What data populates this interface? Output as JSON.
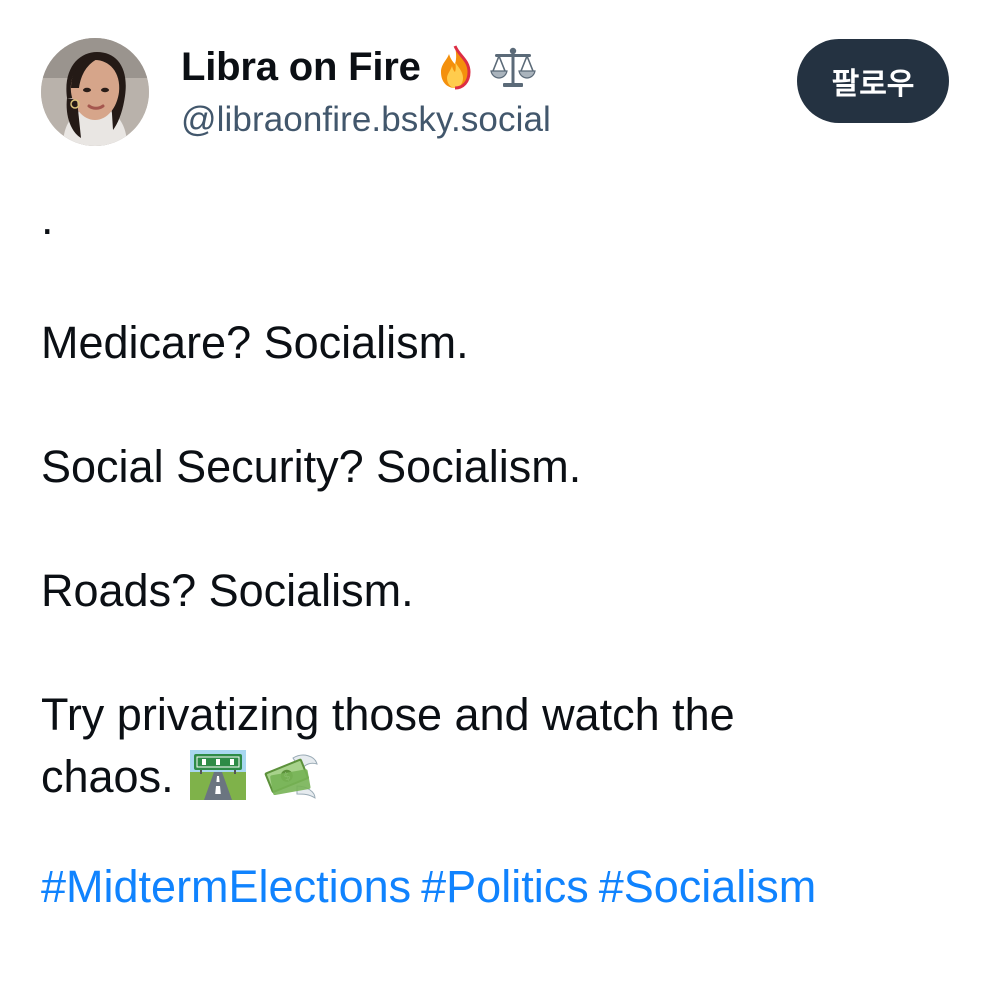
{
  "author": {
    "display_name": "Libra on Fire",
    "handle": "@libraonfire.bsky.social",
    "name_emojis": [
      "fire-icon",
      "balance-scale-icon"
    ]
  },
  "follow_button": {
    "label": "팔로우"
  },
  "post": {
    "lines": [
      ".",
      "Medicare? Socialism.",
      "Social Security? Socialism.",
      "Roads? Socialism.",
      "Try privatizing those and watch the",
      "chaos."
    ],
    "trailing_emojis": [
      "motorway-icon",
      "money-with-wings-icon"
    ],
    "hashtags": [
      "#MidtermElections",
      "#Politics",
      "#Socialism"
    ]
  },
  "colors": {
    "button_bg": "#243241",
    "hashtag": "#1083fe",
    "handle": "#42576c",
    "text": "#0b0f14"
  }
}
